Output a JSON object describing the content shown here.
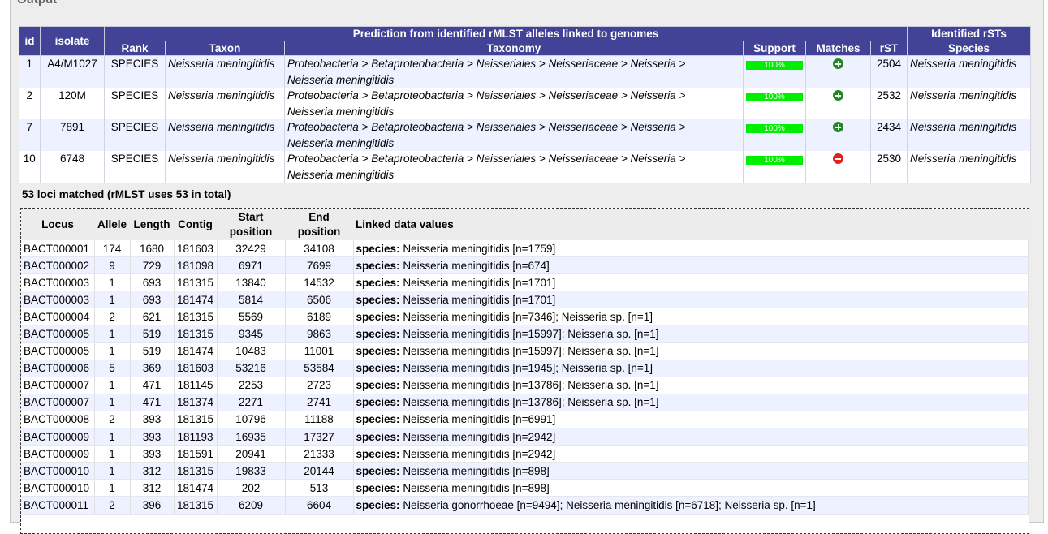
{
  "panel_title": "Output",
  "prediction": {
    "headers": {
      "id": "id",
      "isolate": "isolate",
      "group_prediction": "Prediction from identified rMLST alleles linked to genomes",
      "group_identified": "Identified rSTs",
      "rank": "Rank",
      "taxon": "Taxon",
      "taxonomy": "Taxonomy",
      "support": "Support",
      "matches": "Matches",
      "rst": "rST",
      "species": "Species"
    },
    "rows": [
      {
        "id": "1",
        "isolate": "A4/M1027",
        "rank": "SPECIES",
        "taxon": "Neisseria meningitidis",
        "taxonomy_line1": "Proteobacteria > Betaproteobacteria > Neisseriales > Neisseriaceae > Neisseria >",
        "taxonomy_line2": "Neisseria meningitidis",
        "support": "100%",
        "match": "plus",
        "rst": "2504",
        "species": "Neisseria meningitidis"
      },
      {
        "id": "2",
        "isolate": "120M",
        "rank": "SPECIES",
        "taxon": "Neisseria meningitidis",
        "taxonomy_line1": "Proteobacteria > Betaproteobacteria > Neisseriales > Neisseriaceae > Neisseria >",
        "taxonomy_line2": "Neisseria meningitidis",
        "support": "100%",
        "match": "plus",
        "rst": "2532",
        "species": "Neisseria meningitidis"
      },
      {
        "id": "7",
        "isolate": "7891",
        "rank": "SPECIES",
        "taxon": "Neisseria meningitidis",
        "taxonomy_line1": "Proteobacteria > Betaproteobacteria > Neisseriales > Neisseriaceae > Neisseria >",
        "taxonomy_line2": "Neisseria meningitidis",
        "support": "100%",
        "match": "plus",
        "rst": "2434",
        "species": "Neisseria meningitidis"
      },
      {
        "id": "10",
        "isolate": "6748",
        "rank": "SPECIES",
        "taxon": "Neisseria meningitidis",
        "taxonomy_line1": "Proteobacteria > Betaproteobacteria > Neisseriales > Neisseriaceae > Neisseria >",
        "taxonomy_line2": "Neisseria meningitidis",
        "support": "100%",
        "match": "minus",
        "rst": "2530",
        "species": "Neisseria meningitidis"
      }
    ]
  },
  "summary": "53 loci matched (rMLST uses 53 in total)",
  "loci": {
    "headers": {
      "locus": "Locus",
      "allele": "Allele",
      "length": "Length",
      "contig": "Contig",
      "start_a": "Start",
      "start_b": "position",
      "end_a": "End",
      "end_b": "position",
      "linked": "Linked data values"
    },
    "species_label": "species:",
    "rows": [
      {
        "locus": "BACT000001",
        "allele": "174",
        "length": "1680",
        "contig": "181603",
        "start": "32429",
        "end": "34108",
        "values": "Neisseria meningitidis [n=1759]"
      },
      {
        "locus": "BACT000002",
        "allele": "9",
        "length": "729",
        "contig": "181098",
        "start": "6971",
        "end": "7699",
        "values": "Neisseria meningitidis [n=674]"
      },
      {
        "locus": "BACT000003",
        "allele": "1",
        "length": "693",
        "contig": "181315",
        "start": "13840",
        "end": "14532",
        "values": "Neisseria meningitidis [n=1701]"
      },
      {
        "locus": "BACT000003",
        "allele": "1",
        "length": "693",
        "contig": "181474",
        "start": "5814",
        "end": "6506",
        "values": "Neisseria meningitidis [n=1701]"
      },
      {
        "locus": "BACT000004",
        "allele": "2",
        "length": "621",
        "contig": "181315",
        "start": "5569",
        "end": "6189",
        "values": "Neisseria meningitidis [n=7346]; Neisseria sp. [n=1]"
      },
      {
        "locus": "BACT000005",
        "allele": "1",
        "length": "519",
        "contig": "181315",
        "start": "9345",
        "end": "9863",
        "values": "Neisseria meningitidis [n=15997]; Neisseria sp. [n=1]"
      },
      {
        "locus": "BACT000005",
        "allele": "1",
        "length": "519",
        "contig": "181474",
        "start": "10483",
        "end": "11001",
        "values": "Neisseria meningitidis [n=15997]; Neisseria sp. [n=1]"
      },
      {
        "locus": "BACT000006",
        "allele": "5",
        "length": "369",
        "contig": "181603",
        "start": "53216",
        "end": "53584",
        "values": "Neisseria meningitidis [n=1945]; Neisseria sp. [n=1]"
      },
      {
        "locus": "BACT000007",
        "allele": "1",
        "length": "471",
        "contig": "181145",
        "start": "2253",
        "end": "2723",
        "values": "Neisseria meningitidis [n=13786]; Neisseria sp. [n=1]"
      },
      {
        "locus": "BACT000007",
        "allele": "1",
        "length": "471",
        "contig": "181374",
        "start": "2271",
        "end": "2741",
        "values": "Neisseria meningitidis [n=13786]; Neisseria sp. [n=1]"
      },
      {
        "locus": "BACT000008",
        "allele": "2",
        "length": "393",
        "contig": "181315",
        "start": "10796",
        "end": "11188",
        "values": "Neisseria meningitidis [n=6991]"
      },
      {
        "locus": "BACT000009",
        "allele": "1",
        "length": "393",
        "contig": "181193",
        "start": "16935",
        "end": "17327",
        "values": "Neisseria meningitidis [n=2942]"
      },
      {
        "locus": "BACT000009",
        "allele": "1",
        "length": "393",
        "contig": "181591",
        "start": "20941",
        "end": "21333",
        "values": "Neisseria meningitidis [n=2942]"
      },
      {
        "locus": "BACT000010",
        "allele": "1",
        "length": "312",
        "contig": "181315",
        "start": "19833",
        "end": "20144",
        "values": "Neisseria meningitidis [n=898]"
      },
      {
        "locus": "BACT000010",
        "allele": "1",
        "length": "312",
        "contig": "181474",
        "start": "202",
        "end": "513",
        "values": "Neisseria meningitidis [n=898]"
      },
      {
        "locus": "BACT000011",
        "allele": "2",
        "length": "396",
        "contig": "181315",
        "start": "6209",
        "end": "6604",
        "values": "Neisseria gonorrhoeae [n=9494]; Neisseria meningitidis [n=6718]; Neisseria sp. [n=1]"
      }
    ]
  },
  "colors": {
    "header_bg": "#424296",
    "row_alt": "#eef1ff",
    "support_bar": "#00ee00",
    "match_plus": "#1f8a1f",
    "match_minus": "#e21f1f"
  }
}
